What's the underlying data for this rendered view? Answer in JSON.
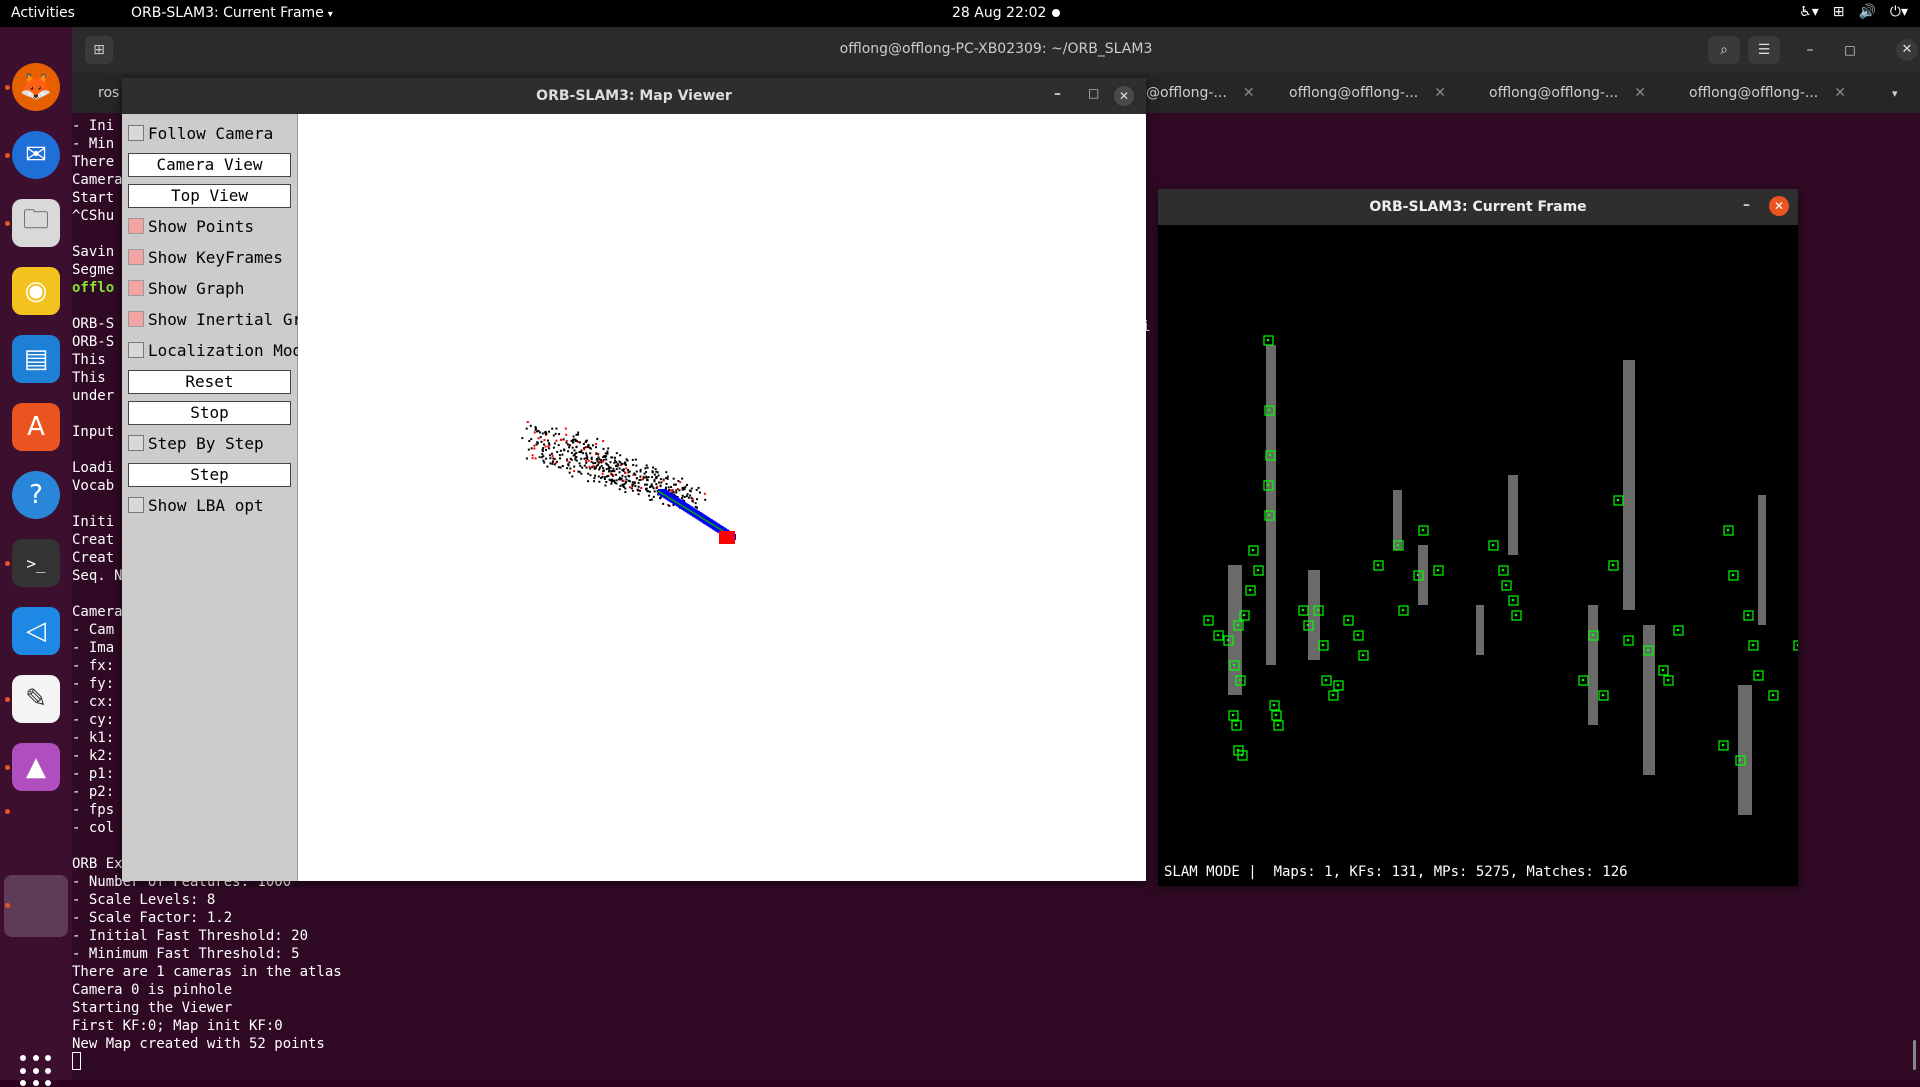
{
  "topbar": {
    "activities": "Activities",
    "app_menu": "ORB-SLAM3: Current Frame",
    "app_menu_caret": "▾",
    "clock": "28 Aug  22:02",
    "tray": {
      "accessibility": "♿▾",
      "network": "⊞",
      "volume": "🔊",
      "power": "⏻▾"
    }
  },
  "dock": {
    "items": [
      {
        "name": "firefox-icon",
        "glyph": "🦊",
        "color": "#e66000"
      },
      {
        "name": "thunderbird-icon",
        "glyph": "✉",
        "color": "#1f6fd8"
      },
      {
        "name": "files-icon",
        "glyph": "🗀",
        "color": "#d9d9d9"
      },
      {
        "name": "rhythmbox-icon",
        "glyph": "◉",
        "color": "#f4c21f"
      },
      {
        "name": "writer-icon",
        "glyph": "▤",
        "color": "#1e7fd6"
      },
      {
        "name": "software-icon",
        "glyph": "A",
        "color": "#e95420"
      },
      {
        "name": "help-icon",
        "glyph": "?",
        "color": "#2a86d8"
      },
      {
        "name": "terminal-icon",
        "glyph": ">_",
        "color": "#333333"
      },
      {
        "name": "vscode-icon",
        "glyph": "◁",
        "color": "#1e88e5"
      },
      {
        "name": "text-editor-icon",
        "glyph": "✎",
        "color": "#f5f5f5"
      },
      {
        "name": "image-viewer-icon",
        "glyph": "▲",
        "color": "#b04ec0"
      }
    ]
  },
  "terminal": {
    "title": "offlong@offlong-PC-XB02309: ~/ORB_SLAM3",
    "tabs": [
      {
        "label": "ros"
      },
      {
        "label": "@offlong-..."
      },
      {
        "label": "offlong@offlong-..."
      },
      {
        "label": "offlong@offlong-..."
      },
      {
        "label": "offlong@offlong-..."
      }
    ],
    "tab_close": "✕",
    "tabs_menu": "▾",
    "lines": [
      {
        "text": "- Ini"
      },
      {
        "text": "- Min"
      },
      {
        "text": "There"
      },
      {
        "text": "Camera"
      },
      {
        "text": "Start"
      },
      {
        "text": "^CShu"
      },
      {
        "text": ""
      },
      {
        "text": "Savin"
      },
      {
        "text": "Segme"
      },
      {
        "text": "offlo",
        "green": true
      },
      {
        "text": ""
      },
      {
        "text": "ORB-S"
      },
      {
        "text": "ORB-S"
      },
      {
        "text": "This"
      },
      {
        "text": "This"
      },
      {
        "text": "under"
      },
      {
        "text": ""
      },
      {
        "text": "Input"
      },
      {
        "text": ""
      },
      {
        "text": "Loadi"
      },
      {
        "text": "Vocab"
      },
      {
        "text": ""
      },
      {
        "text": "Initi"
      },
      {
        "text": "Creat"
      },
      {
        "text": "Creat"
      },
      {
        "text": "Seq. N"
      },
      {
        "text": ""
      },
      {
        "text": "Camera"
      },
      {
        "text": "- Cam"
      },
      {
        "text": "- Ima"
      },
      {
        "text": "- fx:"
      },
      {
        "text": "- fy:"
      },
      {
        "text": "- cx:"
      },
      {
        "text": "- cy:"
      },
      {
        "text": "- k1:"
      },
      {
        "text": "- k2:"
      },
      {
        "text": "- p1:"
      },
      {
        "text": "- p2:"
      },
      {
        "text": "- fps"
      },
      {
        "text": "- col"
      },
      {
        "text": ""
      },
      {
        "text": "ORB Ex"
      },
      {
        "text": "- Number of Features: 1000"
      },
      {
        "text": "- Scale Levels: 8"
      },
      {
        "text": "- Scale Factor: 1.2"
      },
      {
        "text": "- Initial Fast Threshold: 20"
      },
      {
        "text": "- Minimum Fast Threshold: 5"
      },
      {
        "text": "There are 1 cameras in the atlas"
      },
      {
        "text": "Camera 0 is pinhole"
      },
      {
        "text": "Starting the Viewer"
      },
      {
        "text": "First KF:0; Map init KF:0"
      },
      {
        "text": "New Map created with 52 points"
      }
    ],
    "behind_frame_char": "i"
  },
  "map_viewer": {
    "title": "ORB-SLAM3: Map Viewer",
    "controls": [
      {
        "type": "checkbox",
        "label": "Follow Camera",
        "checked": false
      },
      {
        "type": "button",
        "label": "Camera View"
      },
      {
        "type": "button",
        "label": "Top View"
      },
      {
        "type": "checkbox",
        "label": "Show Points",
        "checked": true
      },
      {
        "type": "checkbox",
        "label": "Show KeyFrames",
        "checked": true
      },
      {
        "type": "checkbox",
        "label": "Show Graph",
        "checked": true
      },
      {
        "type": "checkbox",
        "label": "Show Inertial Graph",
        "checked": true
      },
      {
        "type": "checkbox",
        "label": "Localization Mode",
        "checked": false
      },
      {
        "type": "button",
        "label": "Reset"
      },
      {
        "type": "button",
        "label": "Stop"
      },
      {
        "type": "checkbox",
        "label": "Step By Step",
        "checked": false
      },
      {
        "type": "button",
        "label": "Step"
      },
      {
        "type": "checkbox",
        "label": "Show LBA opt",
        "checked": false
      }
    ],
    "colors": {
      "points": "#000000",
      "ref_points": "#ff0000",
      "keyframes": "#0000ff",
      "current_camera": "#ff0000",
      "graph": "#00aa00"
    }
  },
  "current_frame": {
    "title": "ORB-SLAM3: Current Frame",
    "status": "SLAM MODE |  Maps: 1, KFs: 131, MPs: 5275, Matches: 126",
    "feature_color": "#00ff00"
  },
  "window_controls": {
    "minimize": "–",
    "maximize": "□",
    "close": "✕",
    "search": "⌕",
    "menu": "☰",
    "new_tab": "⊞"
  }
}
